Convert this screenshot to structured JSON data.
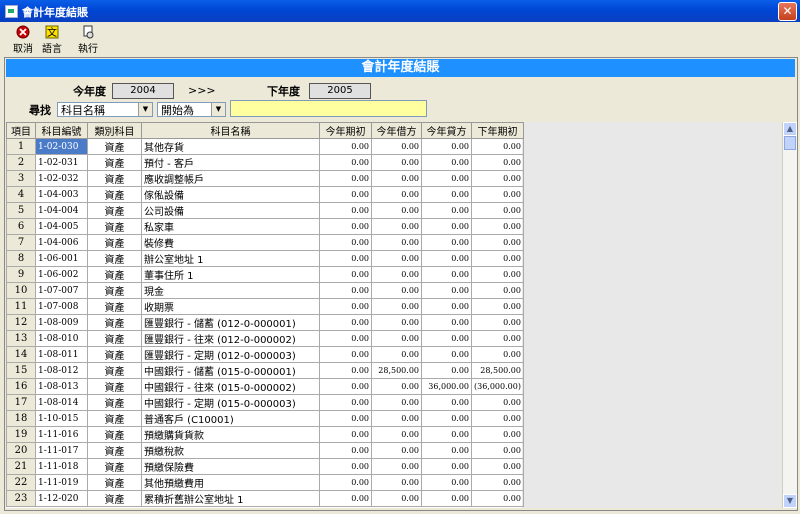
{
  "window": {
    "title": "會計年度結賬"
  },
  "toolbar": [
    {
      "label": "取消",
      "icon": "cancel-icon"
    },
    {
      "label": "語言",
      "icon": "language-icon"
    },
    {
      "label": "執行",
      "icon": "execute-icon"
    }
  ],
  "banner": "會計年度結賬",
  "year": {
    "current_label": "今年度",
    "current_value": "2004",
    "arrow": ">>>",
    "next_label": "下年度",
    "next_value": "2005"
  },
  "search": {
    "label": "尋找",
    "field": "科目名稱",
    "mode": "開始為",
    "value": ""
  },
  "columns": [
    "項目",
    "科目編號",
    "類別科目",
    "科目名稱",
    "今年期初",
    "今年借方",
    "今年貸方",
    "下年期初"
  ],
  "rows": [
    [
      "1",
      "1-02-030",
      "資產",
      "其他存貨",
      "0.00",
      "0.00",
      "0.00",
      "0.00"
    ],
    [
      "2",
      "1-02-031",
      "資產",
      "預付 - 客戶",
      "0.00",
      "0.00",
      "0.00",
      "0.00"
    ],
    [
      "3",
      "1-02-032",
      "資產",
      "應收調整帳戶",
      "0.00",
      "0.00",
      "0.00",
      "0.00"
    ],
    [
      "4",
      "1-04-003",
      "資產",
      "傢俬設備",
      "0.00",
      "0.00",
      "0.00",
      "0.00"
    ],
    [
      "5",
      "1-04-004",
      "資產",
      "公司設備",
      "0.00",
      "0.00",
      "0.00",
      "0.00"
    ],
    [
      "6",
      "1-04-005",
      "資產",
      "私家車",
      "0.00",
      "0.00",
      "0.00",
      "0.00"
    ],
    [
      "7",
      "1-04-006",
      "資產",
      "裝修費",
      "0.00",
      "0.00",
      "0.00",
      "0.00"
    ],
    [
      "8",
      "1-06-001",
      "資產",
      "辦公室地址 1",
      "0.00",
      "0.00",
      "0.00",
      "0.00"
    ],
    [
      "9",
      "1-06-002",
      "資產",
      "董事住所 1",
      "0.00",
      "0.00",
      "0.00",
      "0.00"
    ],
    [
      "10",
      "1-07-007",
      "資產",
      "現金",
      "0.00",
      "0.00",
      "0.00",
      "0.00"
    ],
    [
      "11",
      "1-07-008",
      "資產",
      "收期票",
      "0.00",
      "0.00",
      "0.00",
      "0.00"
    ],
    [
      "12",
      "1-08-009",
      "資產",
      "匯豐銀行 - 儲蓄 (012-0-000001)",
      "0.00",
      "0.00",
      "0.00",
      "0.00"
    ],
    [
      "13",
      "1-08-010",
      "資產",
      "匯豐銀行 - 往來 (012-0-000002)",
      "0.00",
      "0.00",
      "0.00",
      "0.00"
    ],
    [
      "14",
      "1-08-011",
      "資產",
      "匯豐銀行 - 定期 (012-0-000003)",
      "0.00",
      "0.00",
      "0.00",
      "0.00"
    ],
    [
      "15",
      "1-08-012",
      "資產",
      "中國銀行 - 儲蓄 (015-0-000001)",
      "0.00",
      "28,500.00",
      "0.00",
      "28,500.00"
    ],
    [
      "16",
      "1-08-013",
      "資產",
      "中國銀行 - 往來 (015-0-000002)",
      "0.00",
      "0.00",
      "36,000.00",
      "(36,000.00)"
    ],
    [
      "17",
      "1-08-014",
      "資產",
      "中國銀行 - 定期 (015-0-000003)",
      "0.00",
      "0.00",
      "0.00",
      "0.00"
    ],
    [
      "18",
      "1-10-015",
      "資產",
      "普通客戶 (C10001)",
      "0.00",
      "0.00",
      "0.00",
      "0.00"
    ],
    [
      "19",
      "1-11-016",
      "資產",
      "預繳購貨貨款",
      "0.00",
      "0.00",
      "0.00",
      "0.00"
    ],
    [
      "20",
      "1-11-017",
      "資產",
      "預繳稅款",
      "0.00",
      "0.00",
      "0.00",
      "0.00"
    ],
    [
      "21",
      "1-11-018",
      "資產",
      "預繳保險費",
      "0.00",
      "0.00",
      "0.00",
      "0.00"
    ],
    [
      "22",
      "1-11-019",
      "資產",
      "其他預繳費用",
      "0.00",
      "0.00",
      "0.00",
      "0.00"
    ],
    [
      "23",
      "1-12-020",
      "資產",
      "累積折舊辦公室地址 1",
      "0.00",
      "0.00",
      "0.00",
      "0.00"
    ]
  ]
}
